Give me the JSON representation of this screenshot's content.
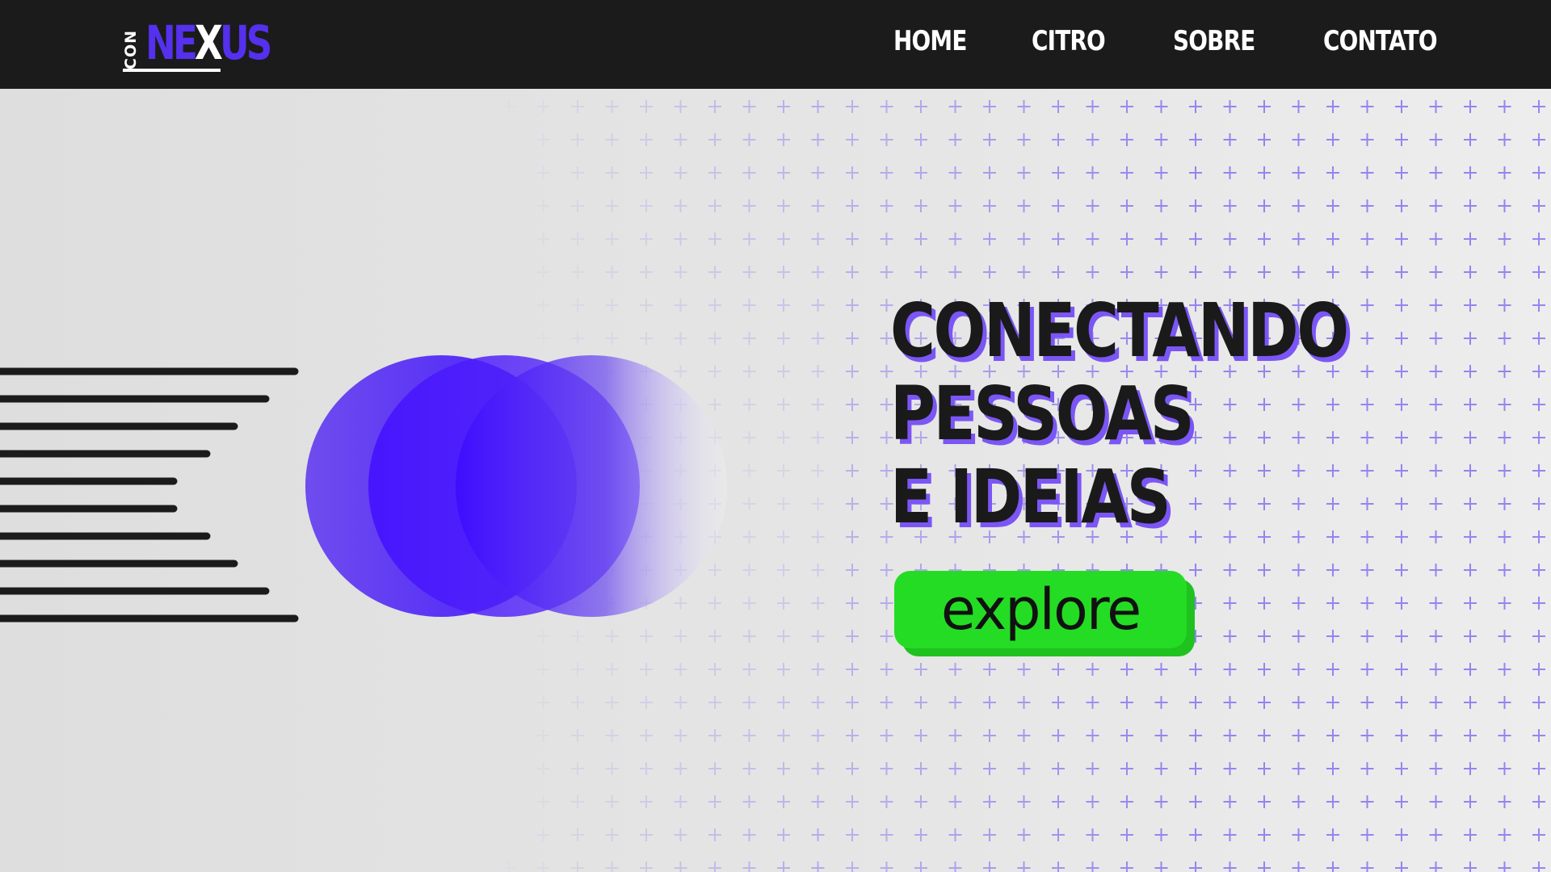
{
  "brand": {
    "logo_prefix": "CON",
    "logo_ne": "NE",
    "logo_x": "X",
    "logo_us": "US",
    "primary_color": "#5530ee",
    "accent_green": "#24dc24",
    "dark_color": "#1b1b1b"
  },
  "nav": {
    "items": [
      {
        "label": "HOME"
      },
      {
        "label": "CITRO"
      },
      {
        "label": "SOBRE"
      },
      {
        "label": "CONTATO"
      }
    ]
  },
  "hero": {
    "headline_lines": [
      "CONECTANDO",
      "PESSOAS",
      "E IDEIAS"
    ],
    "cta_label": "explore",
    "decorations": {
      "speed_lines_icon": "speed-lines-icon",
      "circles_icon": "overlapping-circles-icon",
      "pattern_icon": "plus-pattern-icon"
    }
  }
}
